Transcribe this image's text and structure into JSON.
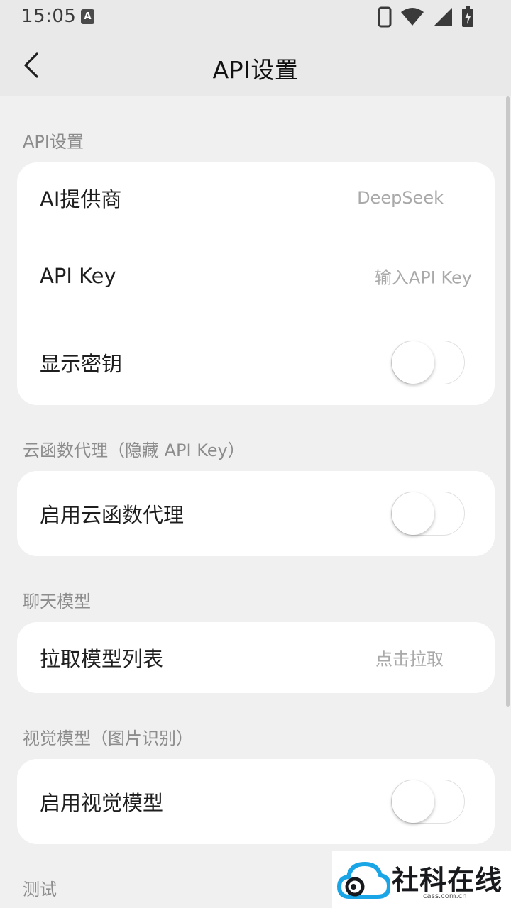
{
  "status_bar": {
    "time": "15:05",
    "badge": "A",
    "icons": [
      "phone-icon",
      "wifi-icon",
      "signal-icon",
      "battery-charging-icon"
    ]
  },
  "app_bar": {
    "title": "API设置",
    "back_icon": "chevron-left-icon"
  },
  "sections": {
    "api": {
      "title": "API设置",
      "provider_label": "AI提供商",
      "provider_value": "DeepSeek",
      "api_key_label": "API Key",
      "api_key_placeholder": "输入API Key",
      "show_key_label": "显示密钥",
      "show_key_on": false
    },
    "proxy": {
      "title": "云函数代理（隐藏 API Key）",
      "enable_label": "启用云函数代理",
      "enable_on": false
    },
    "chat_model": {
      "title": "聊天模型",
      "fetch_label": "拉取模型列表",
      "fetch_value": "点击拉取"
    },
    "vision_model": {
      "title": "视觉模型（图片识别）",
      "enable_label": "启用视觉模型",
      "enable_on": false
    },
    "test": {
      "title": "测试"
    }
  },
  "watermark": {
    "text": "社科在线",
    "sub": "cass.com.cn"
  },
  "colors": {
    "background": "#f0f0f0",
    "card": "#ffffff",
    "section_title": "#8c8c8c",
    "secondary_text": "#a9a9a9",
    "watermark_blue": "#1aa5e6"
  }
}
